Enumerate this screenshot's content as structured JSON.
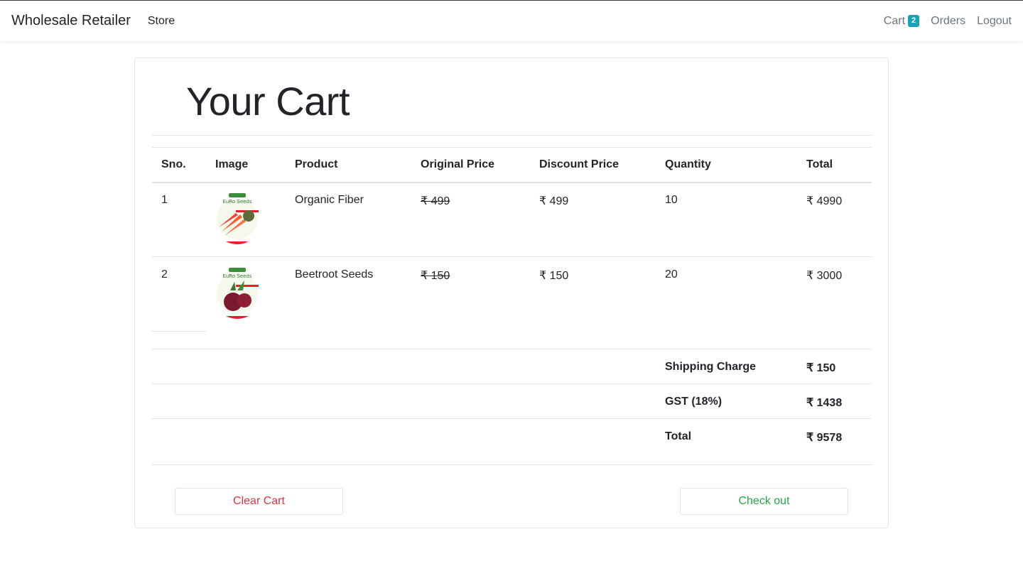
{
  "nav": {
    "brand": "Wholesale Retailer",
    "store": "Store",
    "cart": "Cart",
    "cart_count": "2",
    "orders": "Orders",
    "logout": "Logout"
  },
  "page": {
    "title": "Your Cart"
  },
  "table": {
    "headers": [
      "Sno.",
      "Image",
      "Product",
      "Original Price",
      "Discount Price",
      "Quantity",
      "Total"
    ],
    "rows": [
      {
        "sno": "1",
        "product": "Organic Fiber",
        "original_price": "₹ 499",
        "discount_price": "₹ 499",
        "quantity": "10",
        "total": "₹ 4990",
        "image": "carrot-seed-packet"
      },
      {
        "sno": "2",
        "product": "Beetroot Seeds",
        "original_price": "₹ 150",
        "discount_price": "₹ 150",
        "quantity": "20",
        "total": "₹ 3000",
        "image": "beetroot-seed-packet"
      }
    ]
  },
  "summary": {
    "shipping_label": "Shipping Charge",
    "shipping_value": "₹ 150",
    "gst_label": "GST (18%)",
    "gst_value": "₹ 1438",
    "total_label": "Total",
    "total_value": "₹ 9578"
  },
  "actions": {
    "clear": "Clear Cart",
    "checkout": "Check out"
  },
  "colors": {
    "badge": "#17a2b8",
    "danger": "#dc3545",
    "success": "#28a745",
    "border": "#dee2e6"
  }
}
